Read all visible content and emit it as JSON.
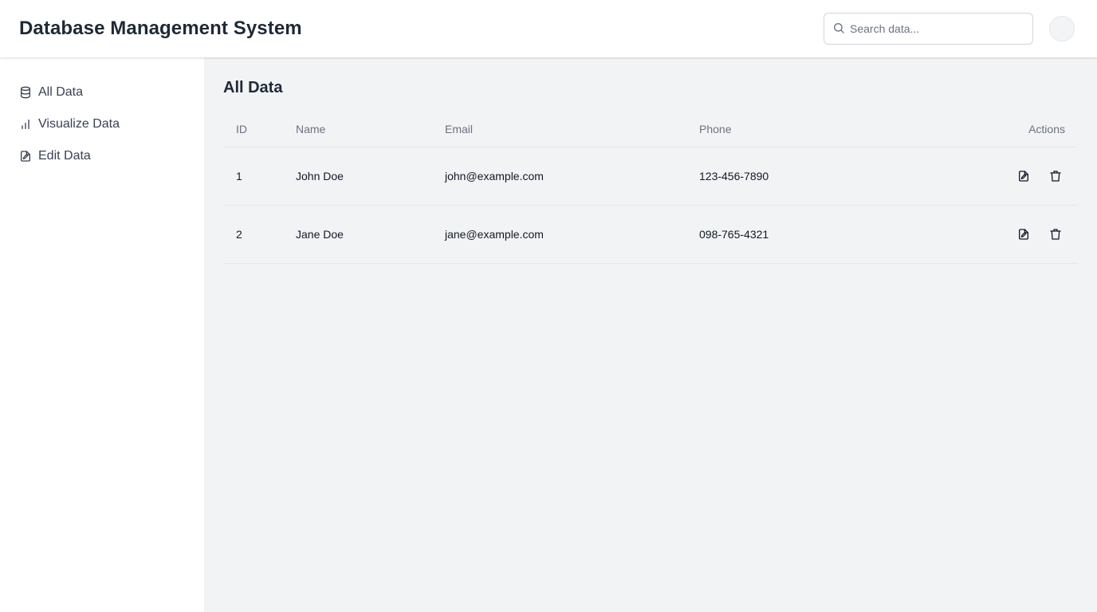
{
  "header": {
    "title": "Database Management System",
    "search": {
      "placeholder": "Search data...",
      "value": ""
    }
  },
  "sidebar": {
    "items": [
      {
        "label": "All Data",
        "icon": "database-icon"
      },
      {
        "label": "Visualize Data",
        "icon": "bar-chart-icon"
      },
      {
        "label": "Edit Data",
        "icon": "file-edit-icon"
      }
    ]
  },
  "main": {
    "title": "All Data",
    "table": {
      "columns": [
        "ID",
        "Name",
        "Email",
        "Phone",
        "Actions"
      ],
      "rows": [
        {
          "id": "1",
          "name": "John Doe",
          "email": "john@example.com",
          "phone": "123-456-7890"
        },
        {
          "id": "2",
          "name": "Jane Doe",
          "email": "jane@example.com",
          "phone": "098-765-4321"
        }
      ]
    }
  },
  "colors": {
    "main_background": "#f2f3f5",
    "text_primary": "#1f2937",
    "text_muted": "#6b7280",
    "border": "#e5e7eb"
  }
}
